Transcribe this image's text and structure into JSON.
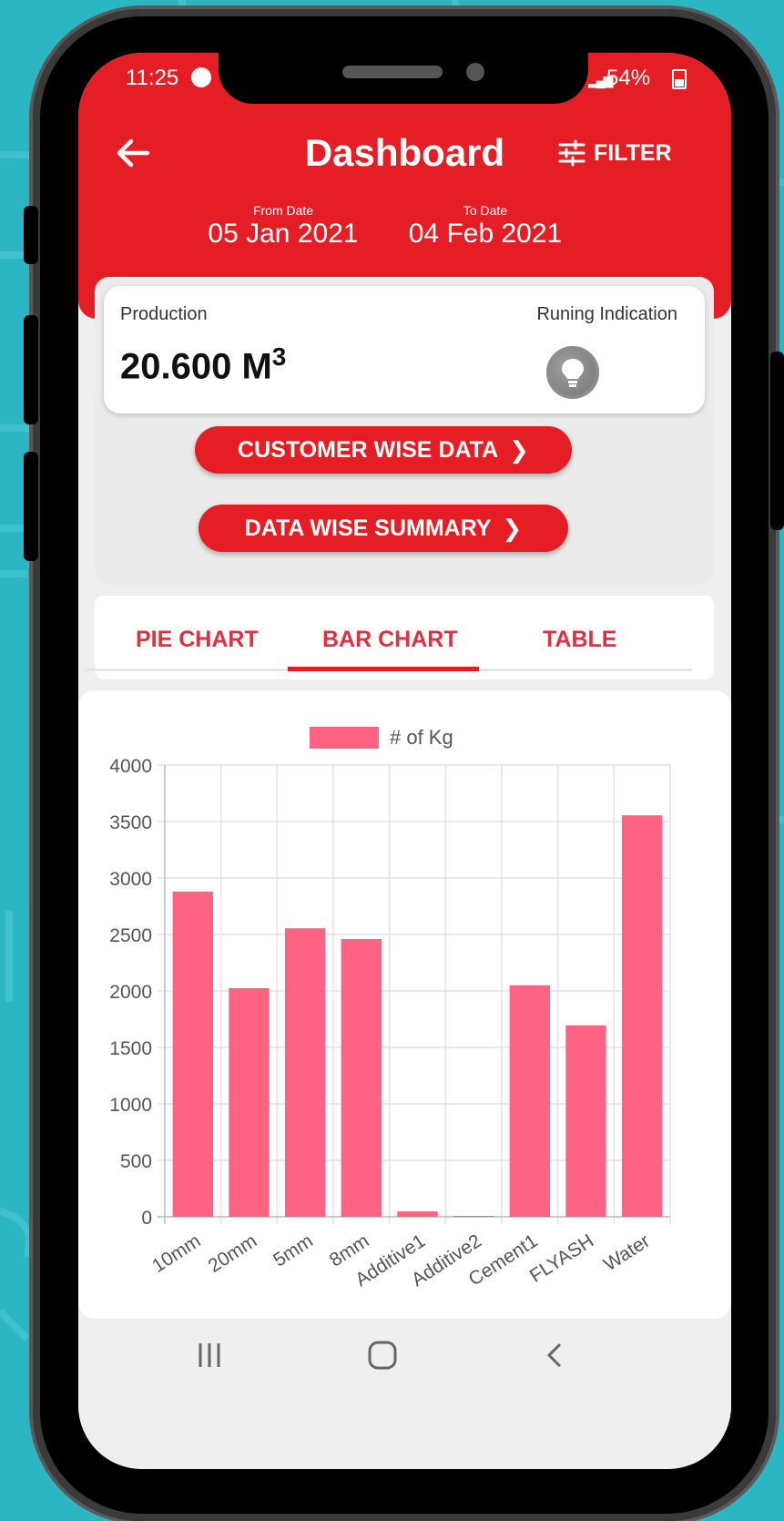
{
  "status_bar": {
    "time": "11:25",
    "battery": "54%"
  },
  "header": {
    "title": "Dashboard",
    "filter_label": "FILTER"
  },
  "dates": {
    "from_label": "From Date",
    "from_value": "05 Jan 2021",
    "to_label": "To Date",
    "to_value": "04 Feb 2021"
  },
  "production": {
    "label": "Production",
    "value": "20.600 M",
    "unit_sup": "3",
    "running_label": "Runing Indication"
  },
  "buttons": {
    "customer_wise": "CUSTOMER WISE DATA",
    "data_wise": "DATA WISE SUMMARY"
  },
  "tabs": [
    {
      "label": "PIE CHART",
      "active": false
    },
    {
      "label": "BAR CHART",
      "active": true
    },
    {
      "label": "TABLE",
      "active": false
    }
  ],
  "colors": {
    "brand_red": "#e51e26",
    "bar_pink": "#ff6384",
    "background_teal": "#2cb6c4"
  },
  "chart_data": {
    "type": "bar",
    "categories": [
      "10mm",
      "20mm",
      "5mm",
      "8mm",
      "Additive1",
      "Additive2",
      "Cement1",
      "FLYASH",
      "Water"
    ],
    "series": [
      {
        "name": "# of Kg",
        "values": [
          2880,
          2025,
          2555,
          2460,
          48,
          8,
          2050,
          1695,
          3555
        ]
      }
    ],
    "ylim": [
      0,
      4000
    ],
    "yticks": [
      "0",
      "500",
      "1000",
      "1500",
      "2000",
      "2500",
      "3000",
      "3500",
      "4000"
    ],
    "grid": true,
    "legend": "top-center"
  },
  "nav_icons": [
    "recent-apps-icon",
    "home-icon",
    "back-nav-icon"
  ]
}
